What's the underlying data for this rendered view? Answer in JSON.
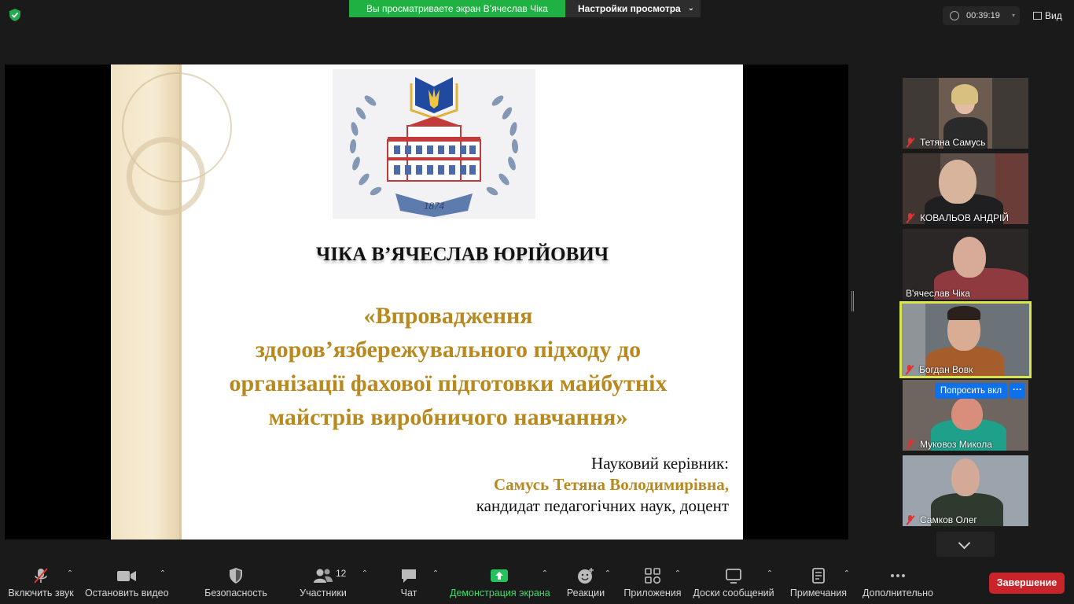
{
  "top": {
    "sharing_banner": "Вы просматриваете экран В’ячеслав Чіка",
    "view_settings": "Настройки просмотра",
    "timer": "00:39:19",
    "view_label": "Вид"
  },
  "slide": {
    "logo_year": "1874",
    "name": "ЧІКА В’ЯЧЕСЛАВ ЮРІЙОВИЧ",
    "title_lines": [
      "«Впровадження",
      "здоров’язбережувального підходу до",
      "організації фахової підготовки майбутніх",
      "майстрів виробничого навчання»"
    ],
    "supervisor_label": "Науковий керівник:",
    "supervisor_name": "Самусь Тетяна Володимирівна,",
    "supervisor_title": "кандидат педагогічних наук, доцент"
  },
  "participants": [
    {
      "name": "Тетяна Самусь",
      "muted": true
    },
    {
      "name": "КОВАЛЬОВ АНДРІЙ",
      "muted": true
    },
    {
      "name": "В'ячеслав Чіка",
      "muted": false
    },
    {
      "name": "Богдан Вовк",
      "muted": true,
      "active": true
    },
    {
      "name": "Муковоз Микола",
      "muted": true
    },
    {
      "name": "Самков Олег",
      "muted": true
    }
  ],
  "tile_actions": {
    "ask_unmute": "Попросить вкл",
    "more": "···"
  },
  "toolbar": {
    "audio": "Включить звук",
    "video": "Остановить видео",
    "security": "Безопасность",
    "participants": "Участники",
    "participants_count": "12",
    "chat": "Чат",
    "share": "Демонстрация экрана",
    "reactions": "Реакции",
    "apps": "Приложения",
    "whiteboards": "Доски сообщений",
    "notes": "Примечания",
    "more": "Дополнительно",
    "end": "Завершение"
  },
  "colors": {
    "share_green": "#1fb141",
    "title_gold": "#b8891f",
    "end_red": "#c8242a",
    "active_speaker": "#d8e64a",
    "ask_blue": "#0e71eb"
  }
}
